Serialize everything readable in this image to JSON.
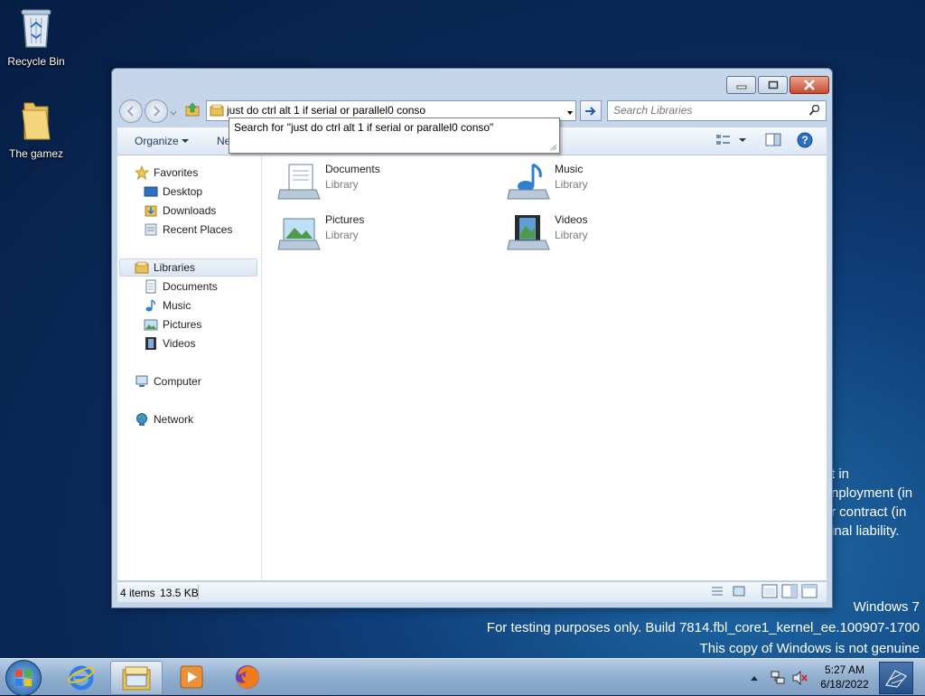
{
  "desktop": {
    "icons": [
      {
        "label": "Recycle Bin"
      },
      {
        "label": "The gamez"
      }
    ],
    "bg_text": [
      "t in",
      "nployment (in",
      "r contract (in",
      "inal liability."
    ],
    "watermark": {
      "line1": "Windows 7",
      "line2": "For testing purposes only. Build 7814.fbl_core1_kernel_ee.100907-1700",
      "line3": "This copy of Windows is not genuine"
    }
  },
  "explorer": {
    "address_value": "just do ctrl alt 1 if serial or parallel0 conso",
    "search_placeholder": "Search Libraries",
    "suggestion": "Search for \"just do ctrl alt 1 if serial or parallel0 conso\"",
    "toolbar": {
      "organize": "Organize",
      "new_partial": "Ne"
    },
    "nav": {
      "favorites": "Favorites",
      "desktop": "Desktop",
      "downloads": "Downloads",
      "recent": "Recent Places",
      "libraries": "Libraries",
      "documents": "Documents",
      "music": "Music",
      "pictures": "Pictures",
      "videos": "Videos",
      "computer": "Computer",
      "network": "Network"
    },
    "libraries": [
      {
        "name": "Documents",
        "type": "Library"
      },
      {
        "name": "Music",
        "type": "Library"
      },
      {
        "name": "Pictures",
        "type": "Library"
      },
      {
        "name": "Videos",
        "type": "Library"
      }
    ],
    "status": {
      "items": "4 items",
      "size": "13.5 KB"
    }
  },
  "taskbar": {
    "time": "5:27 AM",
    "date": "6/18/2022"
  },
  "colors": {
    "accent": "#1e3a5f",
    "window_frame": "#c5d6ea",
    "close": "#c94a2f"
  }
}
